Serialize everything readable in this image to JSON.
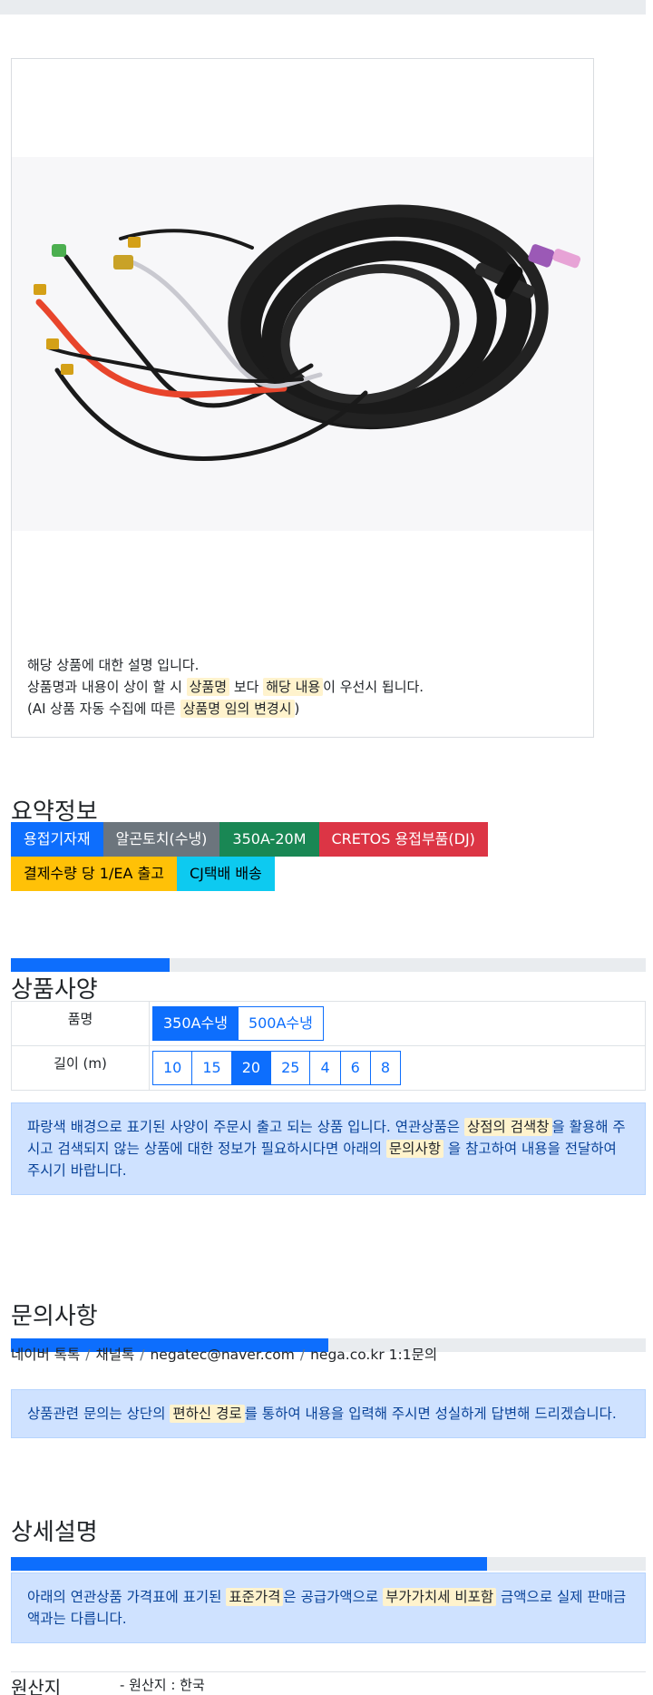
{
  "product": {
    "image_alt": "TIG welding torch cable set",
    "desc_line1": "해당 상품에 대한 설명 입니다.",
    "desc_line2_pre": "상품명과 내용이 상이 할 시 ",
    "desc_line2_hl1": "상품명",
    "desc_line2_mid": " 보다 ",
    "desc_line2_hl2": "해당 내용",
    "desc_line2_post": "이 우선시 됩니다.",
    "desc_line3_pre": "(AI 상품 자동 수집에 따른 ",
    "desc_line3_hl": "상품명 임의 변경시",
    "desc_line3_post": ")"
  },
  "summary": {
    "title": "요약정보",
    "tags_row1": [
      {
        "label": "용접기자재",
        "color": "#0d6efd"
      },
      {
        "label": "알곤토치(수냉)",
        "color": "#6c757d"
      },
      {
        "label": "350A-20M",
        "color": "#198754"
      },
      {
        "label": "CRETOS 용접부품(DJ)",
        "color": "#dc3545"
      }
    ],
    "tags_row2": [
      {
        "label": "결제수량 당 1/EA 출고",
        "color": "#ffc107"
      },
      {
        "label": "CJ택배 배송",
        "color": "#0dcaf0"
      }
    ],
    "progress": 0.25
  },
  "spec": {
    "title": "상품사양",
    "rows": [
      {
        "label": "품명",
        "options": [
          "350A수냉",
          "500A수냉"
        ],
        "selected": "350A수냉"
      },
      {
        "label": "길이 (m)",
        "options": [
          "10",
          "15",
          "20",
          "25",
          "4",
          "6",
          "8"
        ],
        "selected": "20"
      }
    ],
    "note_pre": "파랑색 배경으로 표기된 사양이 주문시 출고 되는 상품 입니다. 연관상품은 ",
    "note_hl1": "상점의 검색창",
    "note_mid": "을 활용해 주시고 검색되지 않는 상품에 대한 정보가 필요하시다면 아래의 ",
    "note_hl2": "문의사항",
    "note_post": " 을 참고하여 내용을 전달하여 주시기 바랍니다."
  },
  "inquiry": {
    "title": "문의사항",
    "progress": 0.5,
    "channels": [
      "네이버 톡톡",
      "채널톡",
      "negatec@naver.com",
      "nega.co.kr 1:1문의"
    ],
    "note_pre": "상품관련 문의는 상단의 ",
    "note_hl": "편하신 경로",
    "note_post": "를 통하여 내용을 입력해 주시면 성실하게 답변해 드리겠습니다."
  },
  "detail": {
    "title": "상세설명",
    "progress": 0.75,
    "note_pre": "아래의 연관상품 가격표에 표기된 ",
    "note_hl1": "표준가격",
    "note_mid": "은 공급가액으로 ",
    "note_hl2": "부가가치세 비포함",
    "note_post": " 금액으로 실제 판매금액과는 다릅니다."
  },
  "origin": {
    "label": "원산지",
    "value": "- 원산지 : 한국"
  }
}
